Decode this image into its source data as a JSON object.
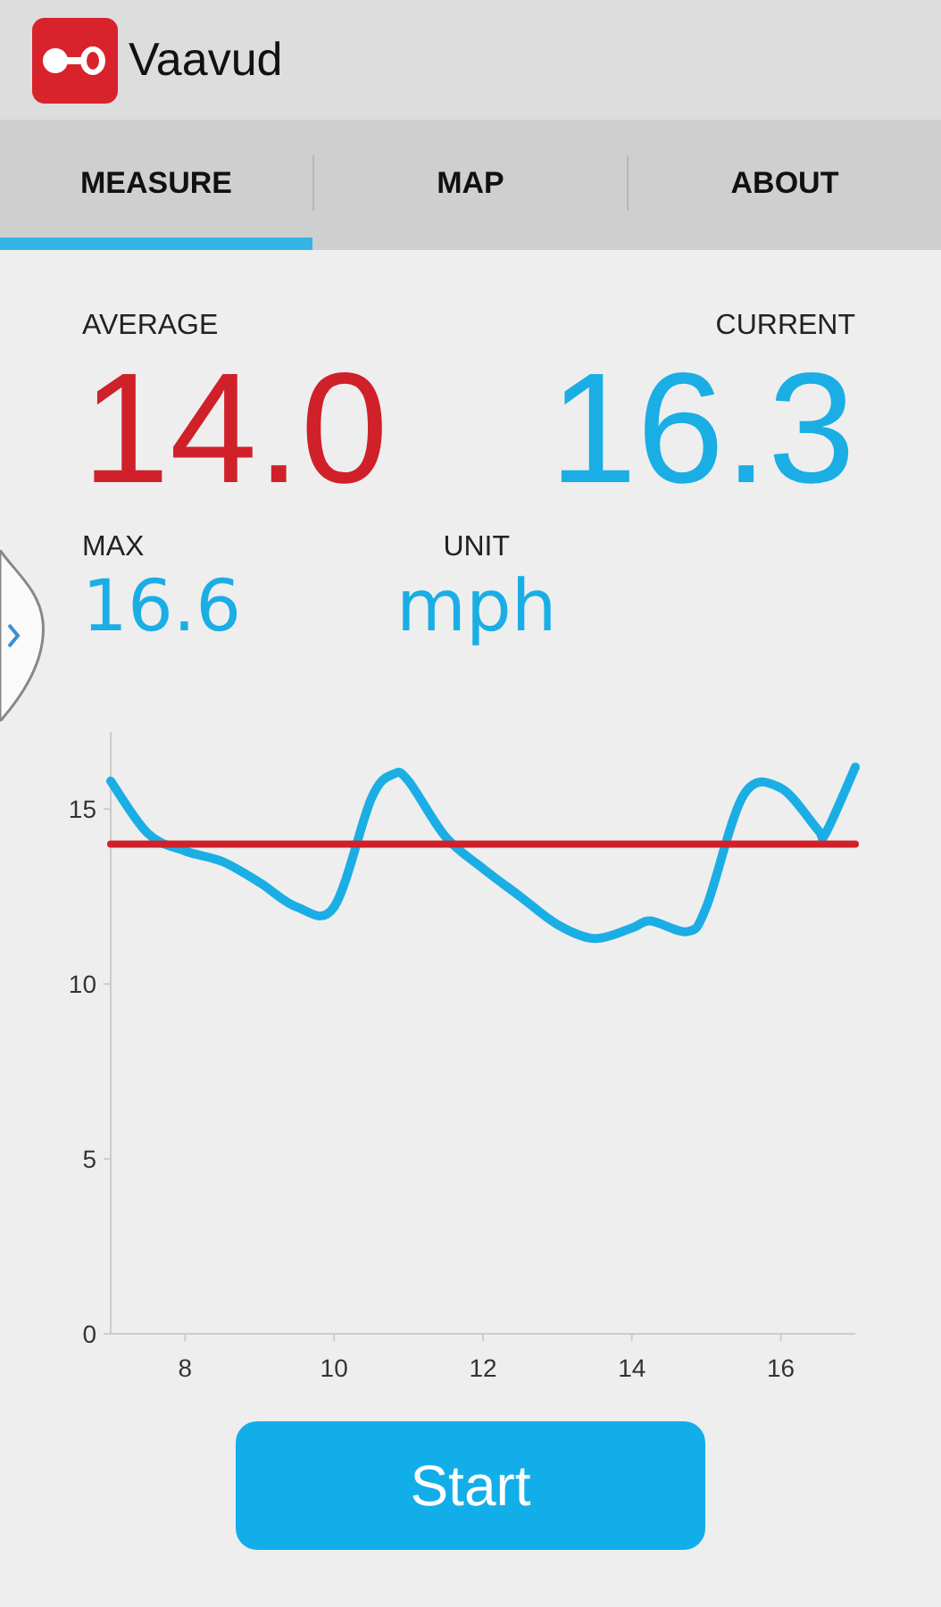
{
  "app_bar": {
    "title": "Vaavud"
  },
  "tabs": [
    {
      "label": "MEASURE",
      "selected": true
    },
    {
      "label": "MAP",
      "selected": false
    },
    {
      "label": "ABOUT",
      "selected": false
    }
  ],
  "readings": {
    "average": {
      "label": "AVERAGE",
      "value": "14.0"
    },
    "current": {
      "label": "CURRENT",
      "value": "16.3"
    },
    "max": {
      "label": "MAX",
      "value": "16.6"
    },
    "unit": {
      "label": "UNIT",
      "value": "mph"
    }
  },
  "chart": {
    "chart_data": {
      "type": "line",
      "x": [
        7,
        7.5,
        8,
        8.5,
        9,
        9.5,
        10,
        10.5,
        10.8,
        11,
        11.5,
        12,
        12.5,
        13,
        13.5,
        14,
        14.25,
        14.75,
        15,
        15.5,
        16,
        16.5,
        16.6,
        17
      ],
      "series": [
        {
          "color": "#1aaee5",
          "values": [
            15.8,
            14.3,
            13.8,
            13.5,
            12.9,
            12.2,
            12.2,
            15.3,
            16.0,
            15.8,
            14.2,
            13.3,
            12.5,
            11.7,
            11.3,
            11.6,
            11.8,
            11.5,
            12.2,
            15.4,
            15.6,
            14.4,
            14.3,
            16.2
          ]
        },
        {
          "color": "#d0202a",
          "values": [
            14,
            14,
            14,
            14,
            14,
            14,
            14,
            14,
            14,
            14,
            14,
            14,
            14,
            14,
            14,
            14,
            14,
            14,
            14,
            14,
            14,
            14,
            14,
            14
          ]
        }
      ],
      "xlim": [
        7,
        17
      ],
      "ylim": [
        0,
        17.2
      ],
      "xticks": [
        8,
        10,
        12,
        14,
        16
      ],
      "yticks": [
        0,
        5,
        10,
        15
      ]
    }
  },
  "start_button": {
    "label": "Start"
  }
}
